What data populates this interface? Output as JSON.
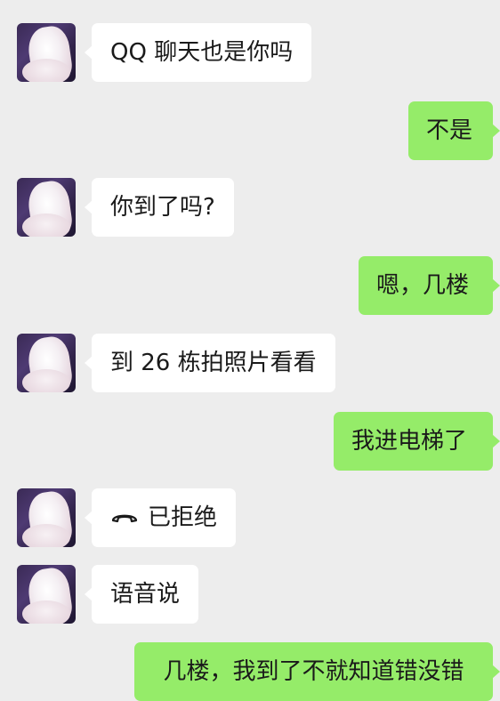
{
  "colors": {
    "background": "#ededed",
    "incoming_bubble": "#ffffff",
    "outgoing_bubble": "#95ec69"
  },
  "messages": [
    {
      "side": "incoming",
      "text": "QQ 聊天也是你吗"
    },
    {
      "side": "outgoing",
      "text": "不是"
    },
    {
      "side": "incoming",
      "text": "你到了吗?"
    },
    {
      "side": "outgoing",
      "text": "嗯，几楼"
    },
    {
      "side": "incoming",
      "text": "到 26 栋拍照片看看"
    },
    {
      "side": "outgoing",
      "text": "我进电梯了"
    },
    {
      "side": "incoming",
      "text": "已拒绝",
      "icon": "phone-hangup-icon"
    },
    {
      "side": "incoming",
      "text": "语音说"
    },
    {
      "side": "outgoing",
      "text": "几楼，我到了不就知道错没错"
    }
  ]
}
